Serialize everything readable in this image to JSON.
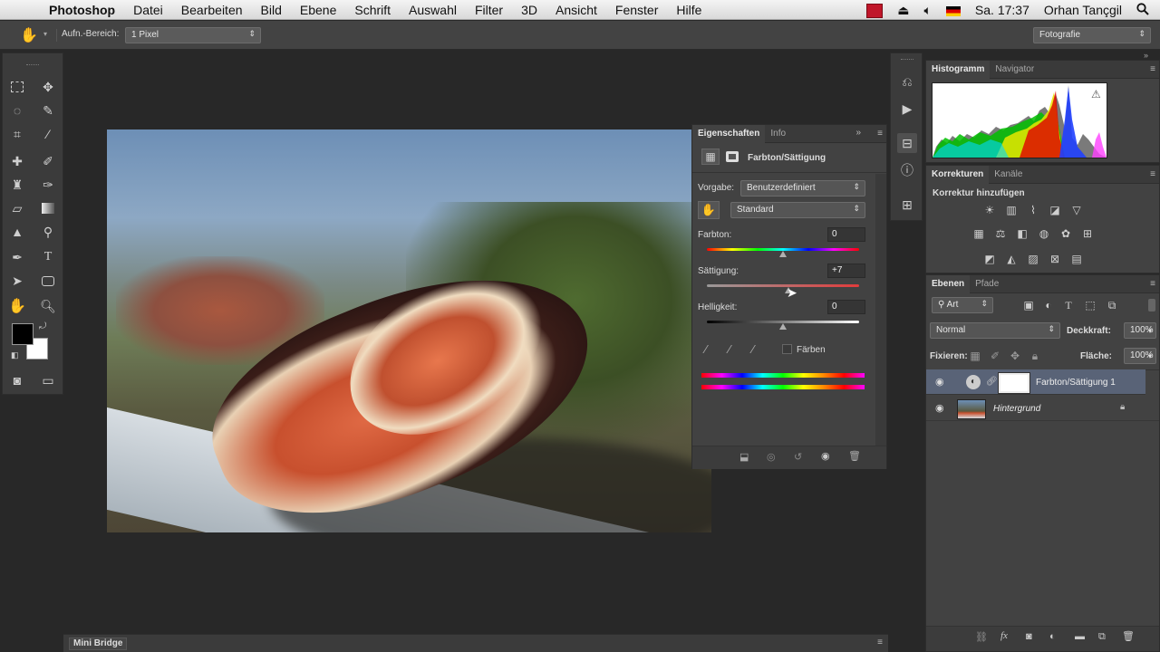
{
  "menubar": {
    "app_name": "Photoshop",
    "items": [
      "Datei",
      "Bearbeiten",
      "Bild",
      "Ebene",
      "Schrift",
      "Auswahl",
      "Filter",
      "3D",
      "Ansicht",
      "Fenster",
      "Hilfe"
    ],
    "clock": "Sa. 17:37",
    "user": "Orhan Tançgil"
  },
  "options_bar": {
    "sample_label": "Aufn.-Bereich:",
    "sample_value": "1 Pixel",
    "workspace": "Fotografie"
  },
  "properties": {
    "tabs": [
      "Eigenschaften",
      "Info"
    ],
    "title": "Farbton/Sättigung",
    "preset_label": "Vorgabe:",
    "preset_value": "Benutzerdefiniert",
    "channel_value": "Standard",
    "hue_label": "Farbton:",
    "hue_value": "0",
    "hue_level": 0,
    "saturation_label": "Sättigung:",
    "saturation_value": "+7",
    "saturation_level": 7,
    "lightness_label": "Helligkeit:",
    "lightness_value": "0",
    "lightness_level": 0,
    "colorize_label": "Färben"
  },
  "histogram": {
    "tabs": [
      "Histogramm",
      "Navigator"
    ]
  },
  "adjustments": {
    "tabs": [
      "Korrekturen",
      "Kanäle"
    ],
    "heading": "Korrektur hinzufügen"
  },
  "layers": {
    "tabs": [
      "Ebenen",
      "Pfade"
    ],
    "filter_kind": "Art",
    "blend_mode": "Normal",
    "opacity_label": "Deckkraft:",
    "opacity_value": "100%",
    "lock_label": "Fixieren:",
    "fill_label": "Fläche:",
    "fill_value": "100%",
    "items": [
      {
        "name": "Farbton/Sättigung 1"
      },
      {
        "name": "Hintergrund"
      }
    ]
  },
  "bottom": {
    "mini_bridge": "Mini Bridge"
  }
}
